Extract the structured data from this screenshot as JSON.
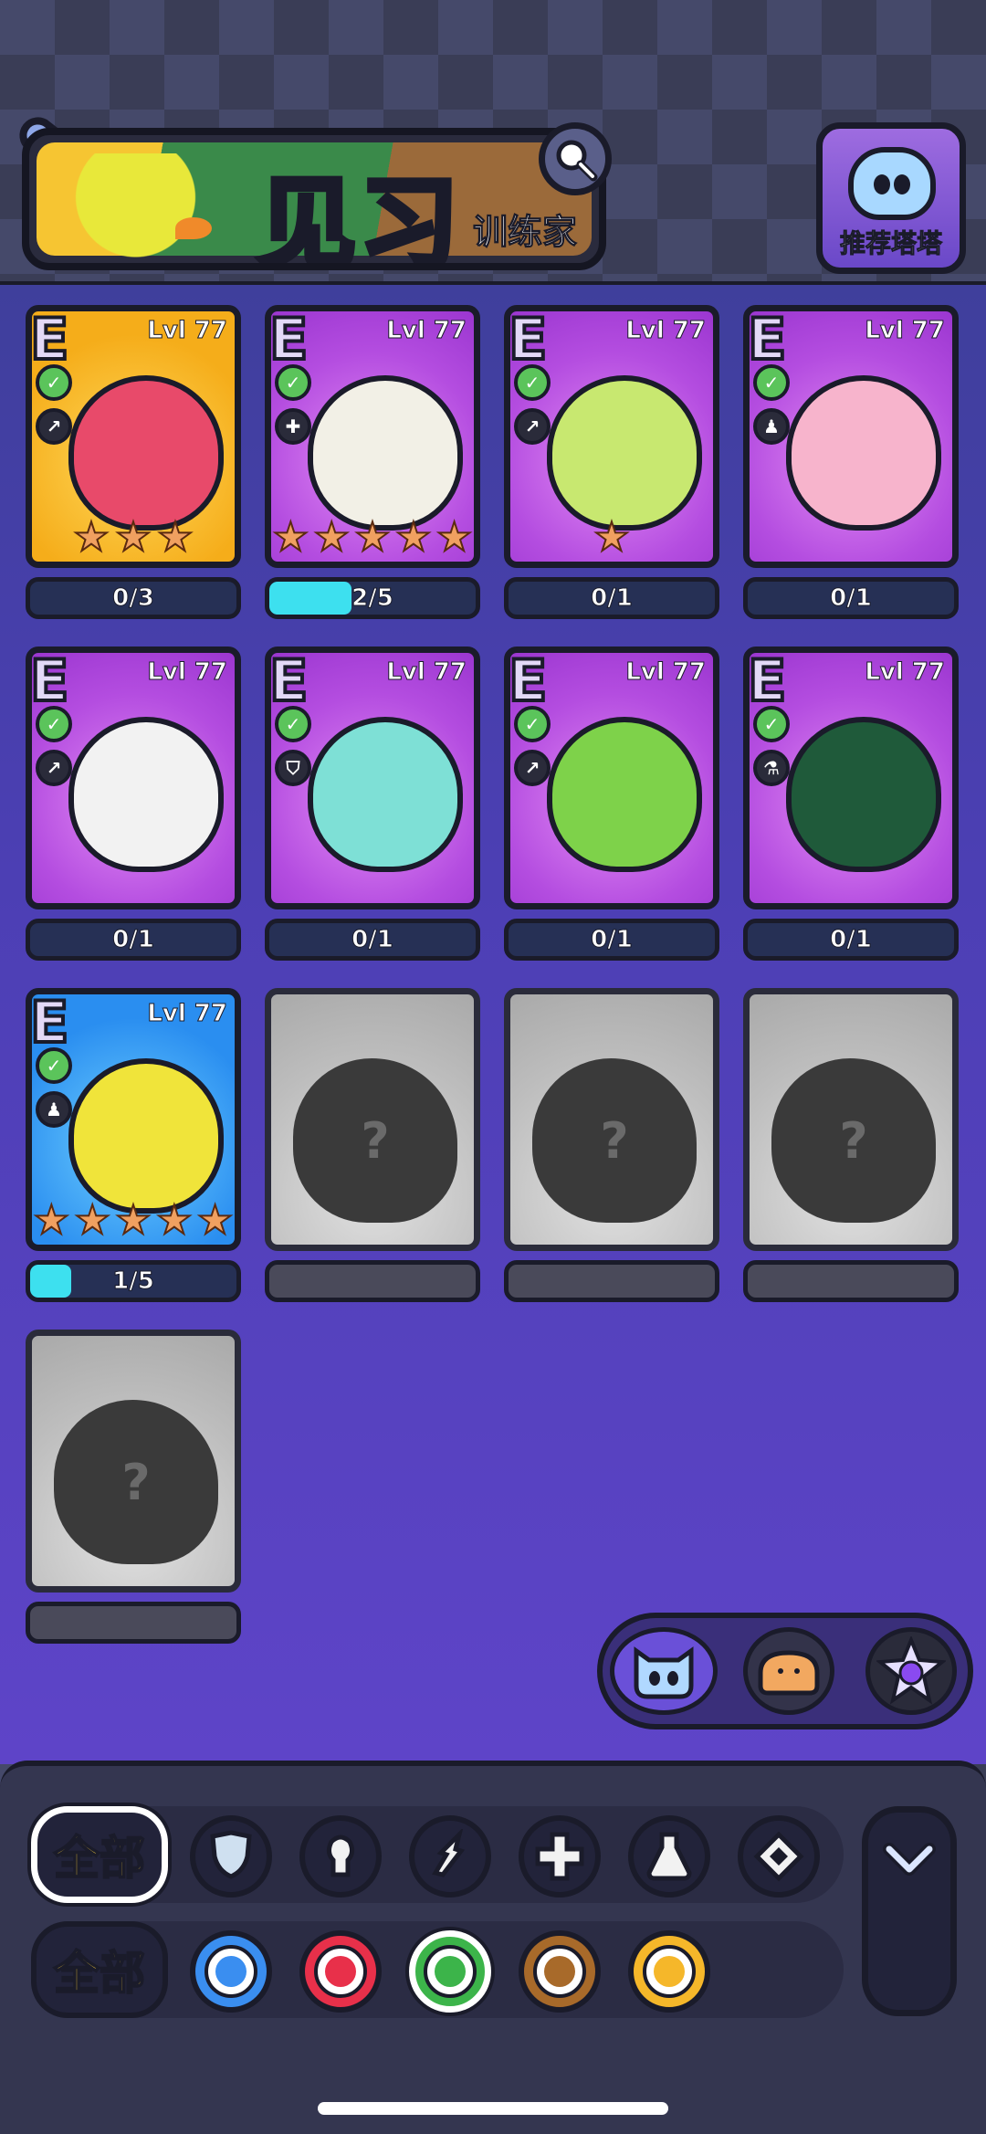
{
  "header": {
    "title": "见习",
    "subtitle": "训练家",
    "recommend_label": "推荐塔塔"
  },
  "cards": [
    {
      "rarity": "E",
      "level": "Lvl 77",
      "bg": "yellow",
      "element": "leaf",
      "role": "attack",
      "stars": 3,
      "progress": "0/3",
      "progress_fraction": 0,
      "creature_color": "#e84a6a"
    },
    {
      "rarity": "E",
      "level": "Lvl 77",
      "bg": "purple",
      "element": "leaf",
      "role": "heal",
      "stars": 5,
      "progress": "2/5",
      "progress_fraction": 0.4,
      "creature_color": "#f2f0e6"
    },
    {
      "rarity": "E",
      "level": "Lvl 77",
      "bg": "purple",
      "element": "leaf",
      "role": "attack",
      "stars": 1,
      "progress": "0/1",
      "progress_fraction": 0,
      "creature_color": "#c8e870"
    },
    {
      "rarity": "E",
      "level": "Lvl 77",
      "bg": "purple",
      "element": "leaf",
      "role": "assassin",
      "stars": 0,
      "progress": "0/1",
      "progress_fraction": 0,
      "creature_color": "#f7b4cc"
    },
    {
      "rarity": "E",
      "level": "Lvl 77",
      "bg": "purple",
      "element": "leaf",
      "role": "attack",
      "stars": 0,
      "progress": "0/1",
      "progress_fraction": 0,
      "creature_color": "#f2f2f2"
    },
    {
      "rarity": "E",
      "level": "Lvl 77",
      "bg": "purple",
      "element": "leaf",
      "role": "defense",
      "stars": 0,
      "progress": "0/1",
      "progress_fraction": 0,
      "creature_color": "#7ee0d6"
    },
    {
      "rarity": "E",
      "level": "Lvl 77",
      "bg": "purple",
      "element": "leaf",
      "role": "attack",
      "stars": 0,
      "progress": "0/1",
      "progress_fraction": 0,
      "creature_color": "#7ed24a"
    },
    {
      "rarity": "E",
      "level": "Lvl 77",
      "bg": "purple",
      "element": "leaf",
      "role": "potion",
      "stars": 0,
      "progress": "0/1",
      "progress_fraction": 0,
      "creature_color": "#1f5a3a"
    },
    {
      "rarity": "E",
      "level": "Lvl 77",
      "bg": "blue",
      "element": "leaf",
      "role": "assassin",
      "stars": 5,
      "progress": "1/5",
      "progress_fraction": 0.2,
      "creature_color": "#f0e43a"
    }
  ],
  "locked_cards": [
    {
      "mark": "?"
    },
    {
      "mark": "?"
    },
    {
      "mark": "?"
    },
    {
      "mark": "?"
    }
  ],
  "selector": {
    "options": [
      "cat-icon",
      "bread-icon",
      "star-cat-icon"
    ],
    "active": 0
  },
  "filters": {
    "all_label": "全部",
    "roles": [
      "defense-icon",
      "assassin-icon",
      "attack-icon",
      "heal-icon",
      "potion-icon",
      "diamond-icon"
    ],
    "elements": [
      {
        "name": "water-icon",
        "color": "#3a8ef0"
      },
      {
        "name": "fire-icon",
        "color": "#e8304a"
      },
      {
        "name": "leaf-icon",
        "color": "#3cb44a",
        "selected": true
      },
      {
        "name": "earth-icon",
        "color": "#a86a2a"
      },
      {
        "name": "lightning-icon",
        "color": "#f5b72a"
      }
    ]
  },
  "colors": {
    "progress_fill": "#3de0ef",
    "accent_yellow": "#ffd43a",
    "title_green": "#9cf0a8"
  }
}
